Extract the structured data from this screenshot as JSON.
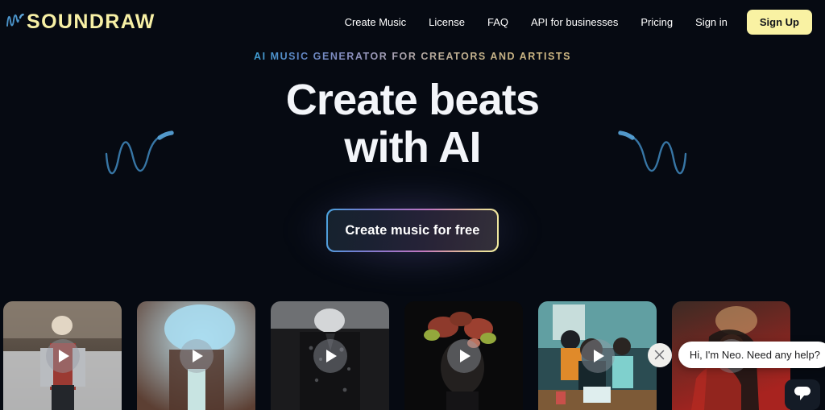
{
  "brand": {
    "name": "SOUNDRAW",
    "logo_mark_icon": "sound-wave-icon",
    "logo_color": "#f7f0a5",
    "wave_color": "#4a93c9"
  },
  "nav": {
    "links": [
      {
        "label": "Create Music"
      },
      {
        "label": "License"
      },
      {
        "label": "FAQ"
      },
      {
        "label": "API for businesses"
      },
      {
        "label": "Pricing"
      },
      {
        "label": "Sign in"
      }
    ],
    "signup_label": "Sign Up",
    "signup_bg": "#f9f2a3"
  },
  "hero": {
    "eyebrow": "AI MUSIC GENERATOR FOR CREATORS AND ARTISTS",
    "headline_line1": "Create beats",
    "headline_line2": "with AI",
    "cta_label": "Create music for free",
    "decor_left_icon": "audio-wave-decoration-icon",
    "decor_right_icon": "audio-wave-decoration-icon"
  },
  "strip": {
    "cards": [
      {
        "name": "video-thumbnail-1",
        "play_icon": "play-icon"
      },
      {
        "name": "video-thumbnail-2",
        "play_icon": "play-icon"
      },
      {
        "name": "video-thumbnail-3",
        "play_icon": "play-icon"
      },
      {
        "name": "video-thumbnail-4",
        "play_icon": "play-icon"
      },
      {
        "name": "video-thumbnail-5",
        "play_icon": "play-icon"
      },
      {
        "name": "video-thumbnail-6",
        "play_icon": "play-icon"
      }
    ]
  },
  "chat": {
    "message": "Hi, I'm Neo. Need any help?",
    "close_icon": "close-icon",
    "launcher_icon": "chat-bubble-icon"
  },
  "theme": {
    "background": "#060a12"
  }
}
